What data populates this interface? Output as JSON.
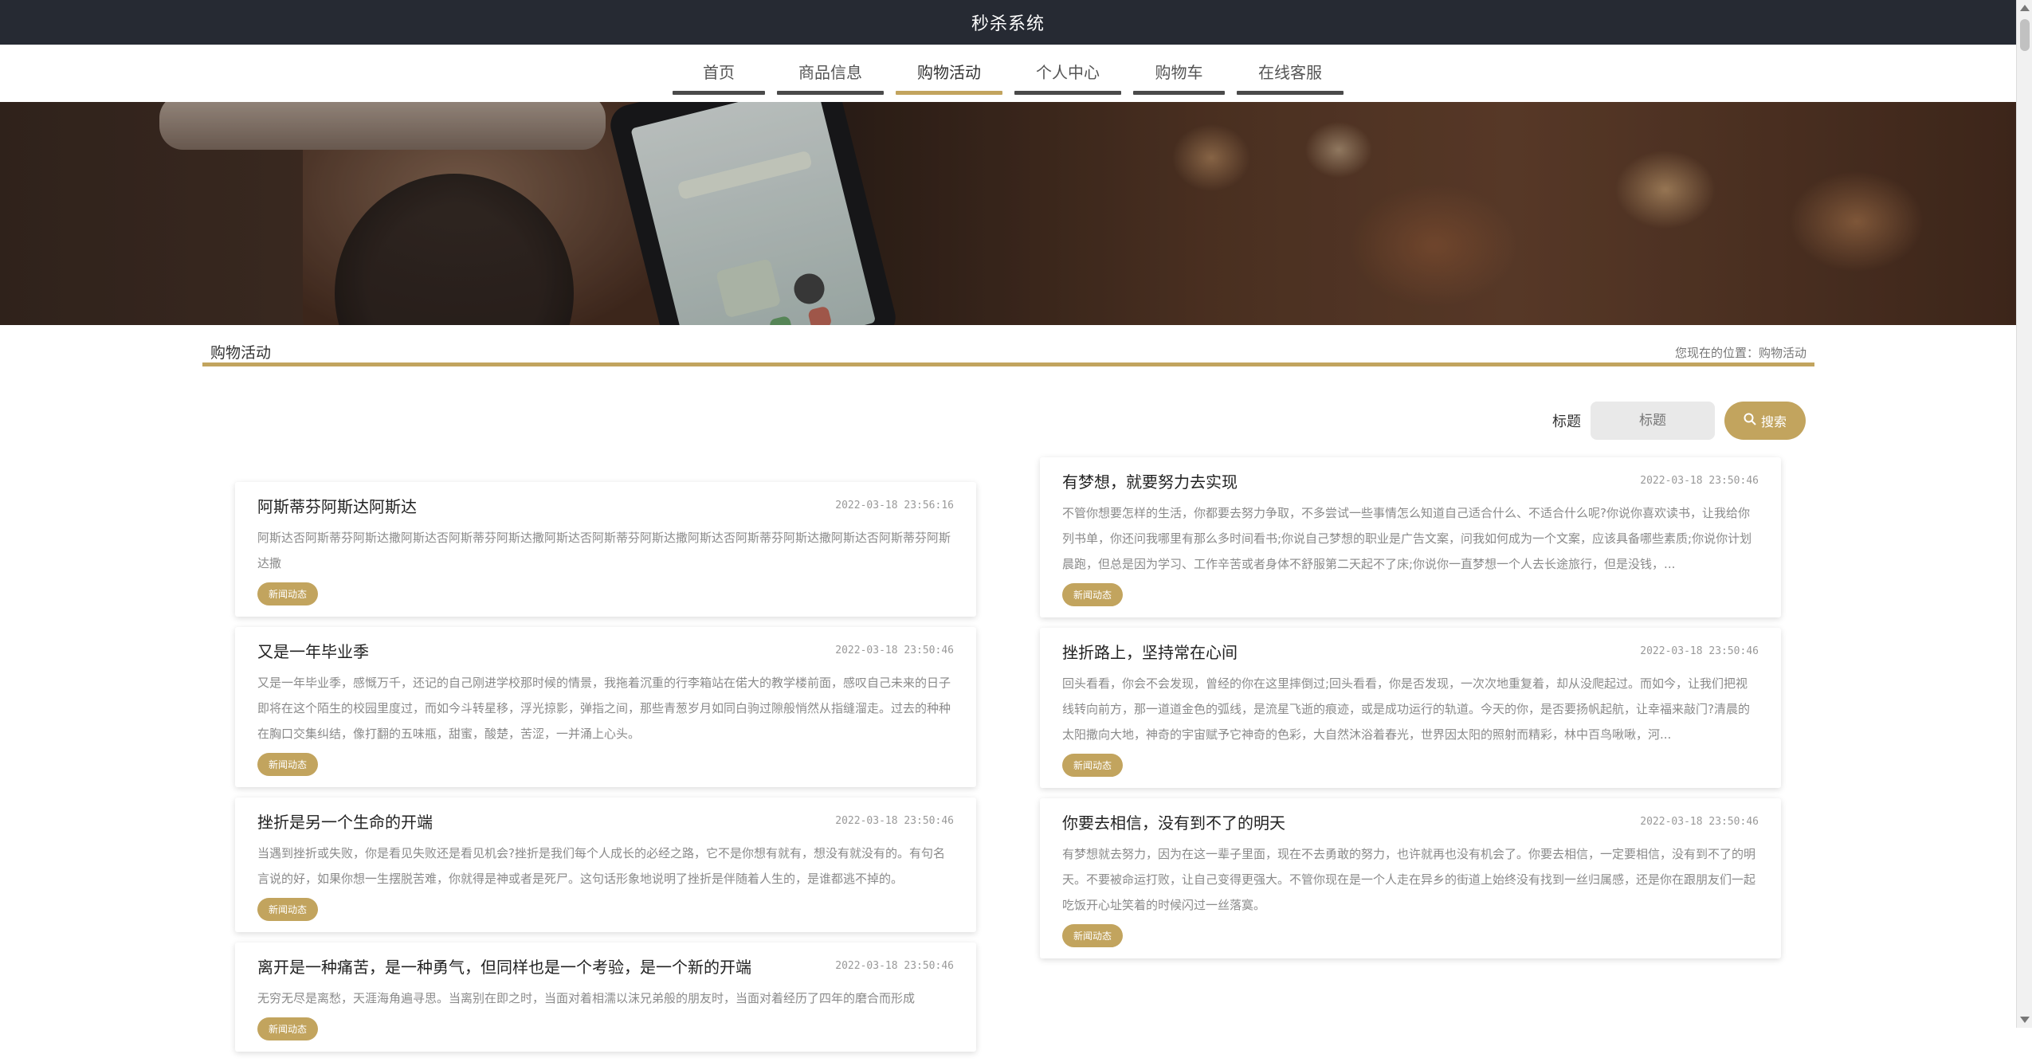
{
  "header": {
    "title": "秒杀系统"
  },
  "nav": {
    "items": [
      {
        "label": "首页",
        "active": false
      },
      {
        "label": "商品信息",
        "active": false
      },
      {
        "label": "购物活动",
        "active": true
      },
      {
        "label": "个人中心",
        "active": false
      },
      {
        "label": "购物车",
        "active": false
      },
      {
        "label": "在线客服",
        "active": false
      }
    ]
  },
  "section": {
    "title": "购物活动",
    "breadcrumb": "您现在的位置：购物活动"
  },
  "search": {
    "label": "标题",
    "placeholder": "标题",
    "button_label": "搜索",
    "button_icon": "search-icon"
  },
  "colors": {
    "accent": "#c2a45e",
    "header_bg": "#262a33",
    "nav_inactive_bar": "#4a4a4a"
  },
  "left_column": [
    {
      "title": "阿斯蒂芬阿斯达阿斯达",
      "time": "2022-03-18 23:56:16",
      "body": "阿斯达否阿斯蒂芬阿斯达撒阿斯达否阿斯蒂芬阿斯达撒阿斯达否阿斯蒂芬阿斯达撒阿斯达否阿斯蒂芬阿斯达撒阿斯达否阿斯蒂芬阿斯达撒",
      "tag": "新闻动态"
    },
    {
      "title": "又是一年毕业季",
      "time": "2022-03-18 23:50:46",
      "body": "又是一年毕业季，感慨万千，还记的自己刚进学校那时候的情景，我拖着沉重的行李箱站在偌大的教学楼前面，感叹自己未来的日子即将在这个陌生的校园里度过，而如今斗转星移，浮光掠影，弹指之间，那些青葱岁月如同白驹过隙般悄然从指缝溜走。过去的种种在胸口交集纠结，像打翻的五味瓶，甜蜜，酸楚，苦涩，一并涌上心头。",
      "tag": "新闻动态"
    },
    {
      "title": "挫折是另一个生命的开端",
      "time": "2022-03-18 23:50:46",
      "body": "当遇到挫折或失败，你是看见失败还是看见机会?挫折是我们每个人成长的必经之路，它不是你想有就有，想没有就没有的。有句名言说的好，如果你想一生摆脱苦难，你就得是神或者是死尸。这句话形象地说明了挫折是伴随着人生的，是谁都逃不掉的。",
      "tag": "新闻动态"
    },
    {
      "title": "离开是一种痛苦，是一种勇气，但同样也是一个考验，是一个新的开端",
      "time": "2022-03-18 23:50:46",
      "body": "无穷无尽是离愁，天涯海角遍寻思。当离别在即之时，当面对着相濡以沫兄弟般的朋友时，当面对着经历了四年的磨合而形成",
      "tag": "新闻动态"
    }
  ],
  "right_column": [
    {
      "title": "有梦想，就要努力去实现",
      "time": "2022-03-18 23:50:46",
      "body": "不管你想要怎样的生活，你都要去努力争取，不多尝试一些事情怎么知道自己适合什么、不适合什么呢?你说你喜欢读书，让我给你列书单，你还问我哪里有那么多时间看书;你说自己梦想的职业是广告文案，问我如何成为一个文案，应该具备哪些素质;你说你计划晨跑，但总是因为学习、工作辛苦或者身体不舒服第二天起不了床;你说你一直梦想一个人去长途旅行，但是没钱，...",
      "tag": "新闻动态"
    },
    {
      "title": "挫折路上，坚持常在心间",
      "time": "2022-03-18 23:50:46",
      "body": "回头看看，你会不会发现，曾经的你在这里摔倒过;回头看看，你是否发现，一次次地重复着，却从没爬起过。而如今，让我们把视线转向前方，那一道道金色的弧线，是流星飞逝的痕迹，或是成功运行的轨道。今天的你，是否要扬帆起航，让幸福来敲门?清晨的太阳撒向大地，神奇的宇宙赋予它神奇的色彩，大自然沐浴着春光，世界因太阳的照射而精彩，林中百鸟啾啾，河...",
      "tag": "新闻动态"
    },
    {
      "title": "你要去相信，没有到不了的明天",
      "time": "2022-03-18 23:50:46",
      "body": "有梦想就去努力，因为在这一辈子里面，现在不去勇敢的努力，也许就再也没有机会了。你要去相信，一定要相信，没有到不了的明天。不要被命运打败，让自己变得更强大。不管你现在是一个人走在异乡的街道上始终没有找到一丝归属感，还是你在跟朋友们一起吃饭开心址笑着的时候闪过一丝落寞。",
      "tag": "新闻动态"
    }
  ]
}
